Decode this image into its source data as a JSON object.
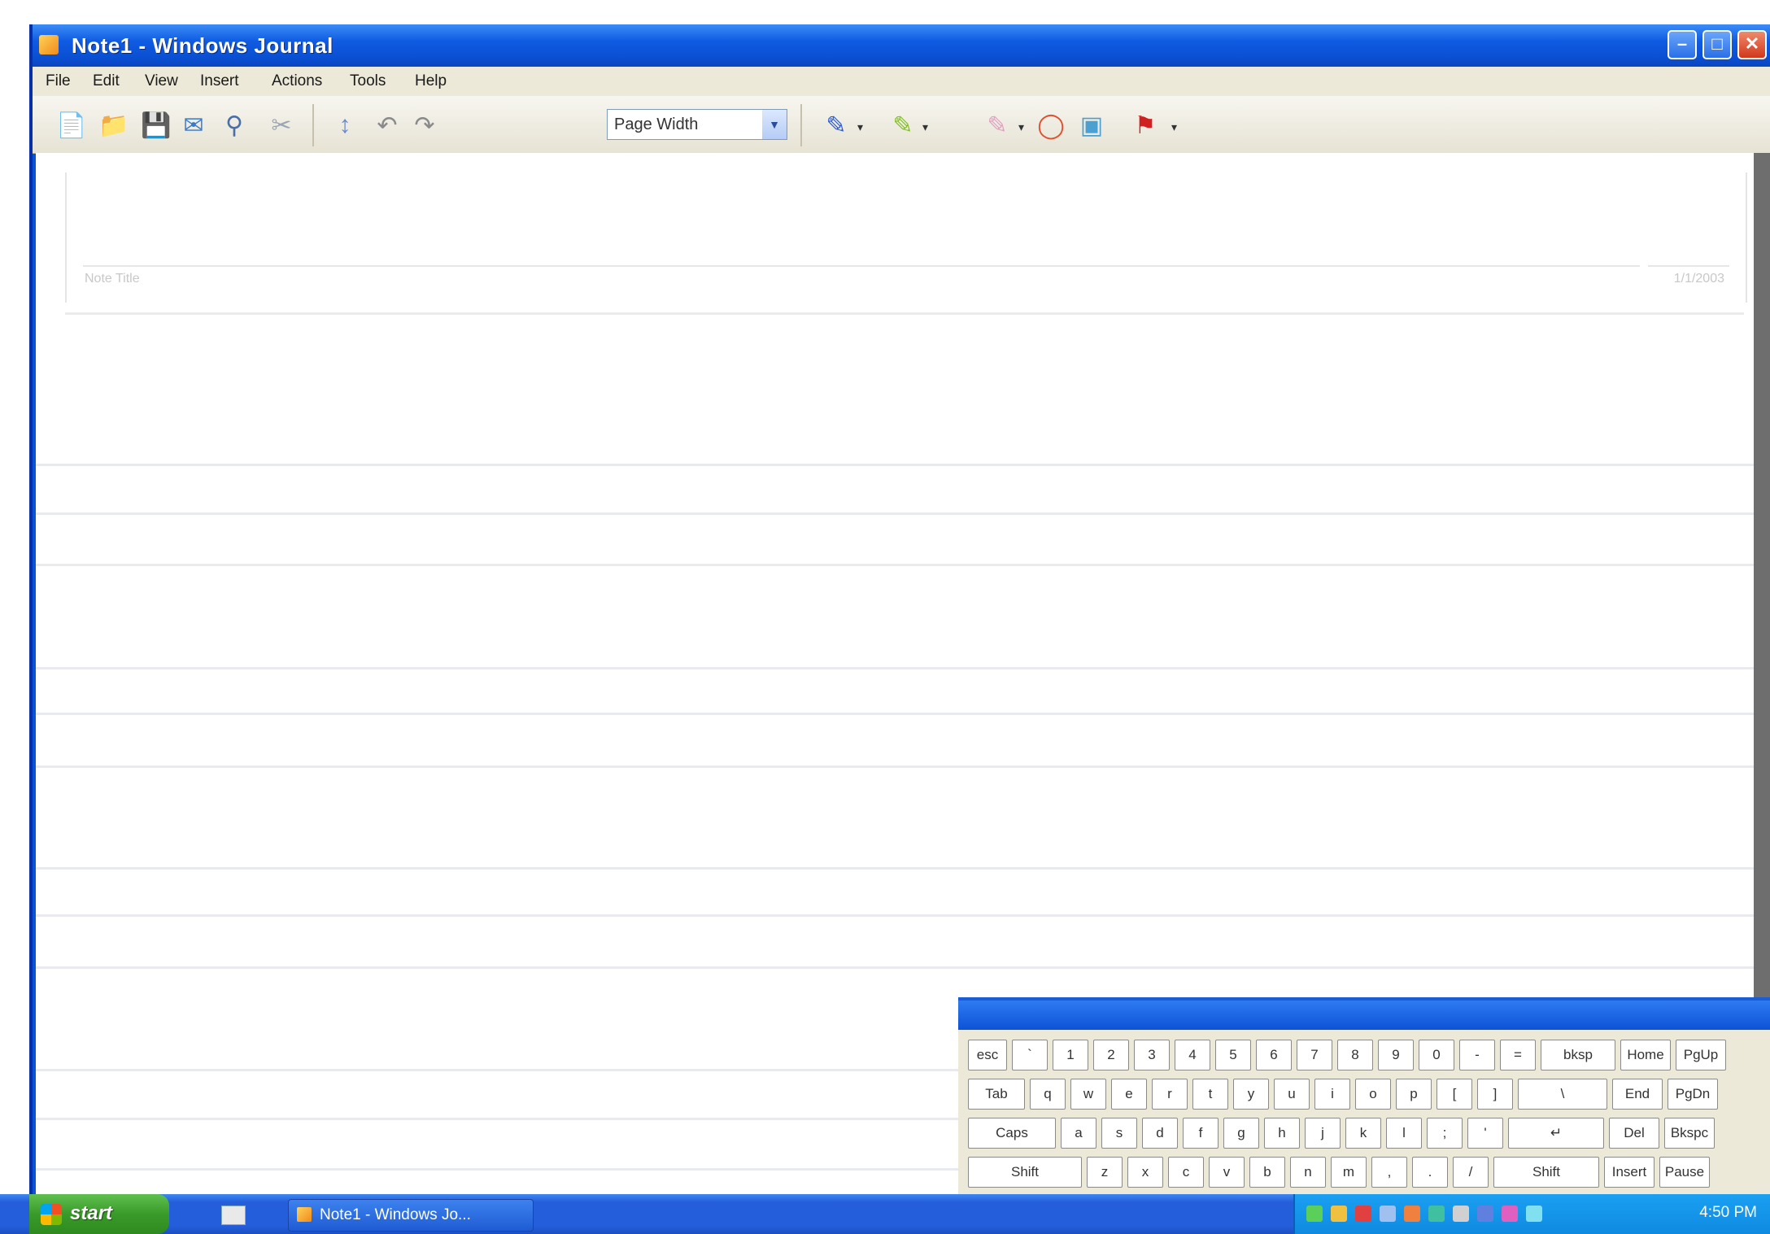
{
  "window": {
    "title": "Note1 - Windows Journal",
    "controls": {
      "minimize": "–",
      "maximize": "□",
      "close": "✕"
    }
  },
  "menu": [
    "File",
    "Edit",
    "View",
    "Insert",
    "Actions",
    "Tools",
    "Help"
  ],
  "toolbar": {
    "view_select_value": "Page Width",
    "icons": [
      "new-note-icon",
      "open-icon",
      "save-icon",
      "send-icon",
      "find-icon",
      "cut-icon",
      "insert-space-icon",
      "undo-icon",
      "redo-icon",
      "pen-icon",
      "highlighter-icon",
      "eraser-icon",
      "lasso-icon",
      "image-icon",
      "flag-icon"
    ]
  },
  "page": {
    "note_title_label": "Note Title",
    "date_label": "1/1/2003"
  },
  "keyboard": {
    "rows": [
      [
        {
          "t": "esc",
          "w": 48
        },
        {
          "t": "`",
          "w": 44
        },
        {
          "t": "1",
          "w": 44
        },
        {
          "t": "2",
          "w": 44
        },
        {
          "t": "3",
          "w": 44
        },
        {
          "t": "4",
          "w": 44
        },
        {
          "t": "5",
          "w": 44
        },
        {
          "t": "6",
          "w": 44
        },
        {
          "t": "7",
          "w": 44
        },
        {
          "t": "8",
          "w": 44
        },
        {
          "t": "9",
          "w": 44
        },
        {
          "t": "0",
          "w": 44
        },
        {
          "t": "-",
          "w": 44
        },
        {
          "t": "=",
          "w": 44
        },
        {
          "t": "bksp",
          "w": 92
        },
        {
          "t": "Home",
          "w": 62
        },
        {
          "t": "PgUp",
          "w": 62
        }
      ],
      [
        {
          "t": "Tab",
          "w": 70
        },
        {
          "t": "q",
          "w": 44
        },
        {
          "t": "w",
          "w": 44
        },
        {
          "t": "e",
          "w": 44
        },
        {
          "t": "r",
          "w": 44
        },
        {
          "t": "t",
          "w": 44
        },
        {
          "t": "y",
          "w": 44
        },
        {
          "t": "u",
          "w": 44
        },
        {
          "t": "i",
          "w": 44
        },
        {
          "t": "o",
          "w": 44
        },
        {
          "t": "p",
          "w": 44
        },
        {
          "t": "[",
          "w": 44
        },
        {
          "t": "]",
          "w": 44
        },
        {
          "t": "\\",
          "w": 110
        },
        {
          "t": "End",
          "w": 62
        },
        {
          "t": "PgDn",
          "w": 62
        }
      ],
      [
        {
          "t": "Caps",
          "w": 108
        },
        {
          "t": "a",
          "w": 44
        },
        {
          "t": "s",
          "w": 44
        },
        {
          "t": "d",
          "w": 44
        },
        {
          "t": "f",
          "w": 44
        },
        {
          "t": "g",
          "w": 44
        },
        {
          "t": "h",
          "w": 44
        },
        {
          "t": "j",
          "w": 44
        },
        {
          "t": "k",
          "w": 44
        },
        {
          "t": "l",
          "w": 44
        },
        {
          "t": ";",
          "w": 44
        },
        {
          "t": "'",
          "w": 44
        },
        {
          "t": "↵",
          "w": 118
        },
        {
          "t": "Del",
          "w": 62
        },
        {
          "t": "Bkspc",
          "w": 62
        }
      ],
      [
        {
          "t": "Shift",
          "w": 140
        },
        {
          "t": "z",
          "w": 44
        },
        {
          "t": "x",
          "w": 44
        },
        {
          "t": "c",
          "w": 44
        },
        {
          "t": "v",
          "w": 44
        },
        {
          "t": "b",
          "w": 44
        },
        {
          "t": "n",
          "w": 44
        },
        {
          "t": "m",
          "w": 44
        },
        {
          "t": ",",
          "w": 44
        },
        {
          "t": ".",
          "w": 44
        },
        {
          "t": "/",
          "w": 44
        },
        {
          "t": "Shift",
          "w": 130
        },
        {
          "t": "Insert",
          "w": 62
        },
        {
          "t": "Pause",
          "w": 62
        }
      ]
    ]
  },
  "taskbar": {
    "start_label": "start",
    "task_button": "Note1 - Windows Jo...",
    "clock": "4:50 PM"
  },
  "colors": {
    "xp_blue": "#0a53d8",
    "start_green": "#3a9a2a",
    "ruled_line": "#e8eaee"
  }
}
